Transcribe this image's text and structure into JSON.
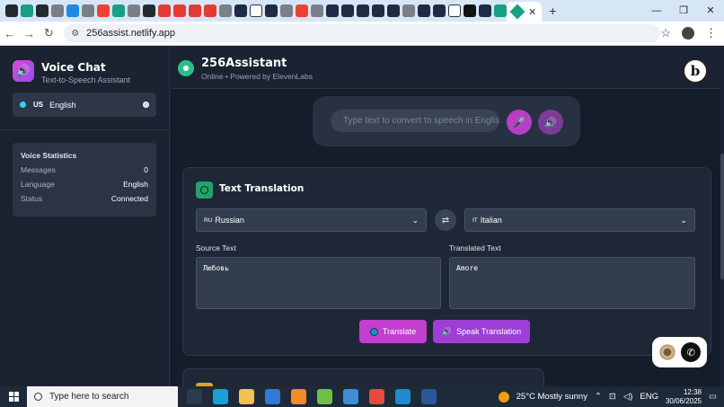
{
  "browser": {
    "url": "256assist.netlify.app",
    "pinned_tabs": [
      {
        "icon": "github-icon",
        "color": "#24292f"
      },
      {
        "icon": "diamond-icon",
        "color": "#16a085"
      },
      {
        "icon": "github-icon",
        "color": "#24292f"
      },
      {
        "icon": "globe-icon",
        "color": "#7a7f87"
      },
      {
        "icon": "blue-app-icon",
        "color": "#1e88e5"
      },
      {
        "icon": "globe-icon",
        "color": "#7a7f87"
      },
      {
        "icon": "google-icon",
        "color": "#ea4335"
      },
      {
        "icon": "diamond-icon",
        "color": "#16a085"
      },
      {
        "icon": "globe-icon",
        "color": "#7a7f87"
      },
      {
        "icon": "github-icon",
        "color": "#24292f"
      },
      {
        "icon": "youtube-icon",
        "color": "#e53935"
      },
      {
        "icon": "youtube-icon",
        "color": "#e53935"
      },
      {
        "icon": "youtube-icon",
        "color": "#e53935"
      },
      {
        "icon": "youtube-icon",
        "color": "#e53935"
      },
      {
        "icon": "globe-icon",
        "color": "#7a7f87"
      },
      {
        "icon": "app-icon",
        "color": "#1f2a44"
      },
      {
        "icon": "notion-icon",
        "color": "#ffffff"
      },
      {
        "icon": "app-icon",
        "color": "#1f2a44"
      },
      {
        "icon": "globe-icon",
        "color": "#7a7f87"
      },
      {
        "icon": "google-icon",
        "color": "#ea4335"
      },
      {
        "icon": "globe-icon",
        "color": "#7a7f87"
      },
      {
        "icon": "app-icon",
        "color": "#1f2a44"
      },
      {
        "icon": "app-icon",
        "color": "#1f2a44"
      },
      {
        "icon": "app-icon",
        "color": "#1f2a44"
      },
      {
        "icon": "app-icon",
        "color": "#1f2a44"
      },
      {
        "icon": "app-icon",
        "color": "#1f2a44"
      },
      {
        "icon": "grid-icon",
        "color": "#7a7f87"
      },
      {
        "icon": "app-icon",
        "color": "#1f2a44"
      },
      {
        "icon": "app-icon",
        "color": "#1f2a44"
      },
      {
        "icon": "notion-icon",
        "color": "#ffffff"
      },
      {
        "icon": "tiktok-icon",
        "color": "#111111"
      },
      {
        "icon": "app-icon",
        "color": "#1f2a44"
      },
      {
        "icon": "diamond-icon",
        "color": "#16a085"
      }
    ]
  },
  "sidebar": {
    "app_name": "Voice Chat",
    "app_subtitle": "Text-to-Speech Assistant",
    "language": {
      "code": "US",
      "name": "English"
    },
    "stats": {
      "title": "Voice Statistics",
      "rows": [
        {
          "label": "Messages",
          "value": "0"
        },
        {
          "label": "Language",
          "value": "English"
        },
        {
          "label": "Status",
          "value": "Connected"
        }
      ]
    }
  },
  "header": {
    "title": "256Assistant",
    "status": "Online • Powered by ElevenLabs",
    "logo_letter": "b"
  },
  "tts": {
    "placeholder": "Type text to convert to speech in English..."
  },
  "translation": {
    "title": "Text Translation",
    "source_lang": {
      "code": "RU",
      "name": "Russian"
    },
    "target_lang": {
      "code": "IT",
      "name": "Italian"
    },
    "source_label": "Source Text",
    "target_label": "Translated Text",
    "source_text": "Любовь",
    "target_text": "Amore",
    "translate_label": "Translate",
    "speak_label": "Speak Translation"
  },
  "taskbar": {
    "search_placeholder": "Type here to search",
    "weather": "25°C  Mostly sunny",
    "lang": "ENG",
    "time": "12:38",
    "date": "30/06/2025",
    "apps": [
      {
        "icon": "task-view-icon",
        "color": "#2b3a4d"
      },
      {
        "icon": "edge-icon",
        "color": "#1aa0d8"
      },
      {
        "icon": "file-explorer-icon",
        "color": "#f2c14e"
      },
      {
        "icon": "store-icon",
        "color": "#2f7ad6"
      },
      {
        "icon": "vlc-icon",
        "color": "#f28c28"
      },
      {
        "icon": "network-icon",
        "color": "#6fbf4a"
      },
      {
        "icon": "photos-icon",
        "color": "#3b8fd8"
      },
      {
        "icon": "chrome-icon",
        "color": "#e44b3c"
      },
      {
        "icon": "vscode-icon",
        "color": "#1f8ad2"
      },
      {
        "icon": "word-icon",
        "color": "#2b5797"
      }
    ]
  }
}
